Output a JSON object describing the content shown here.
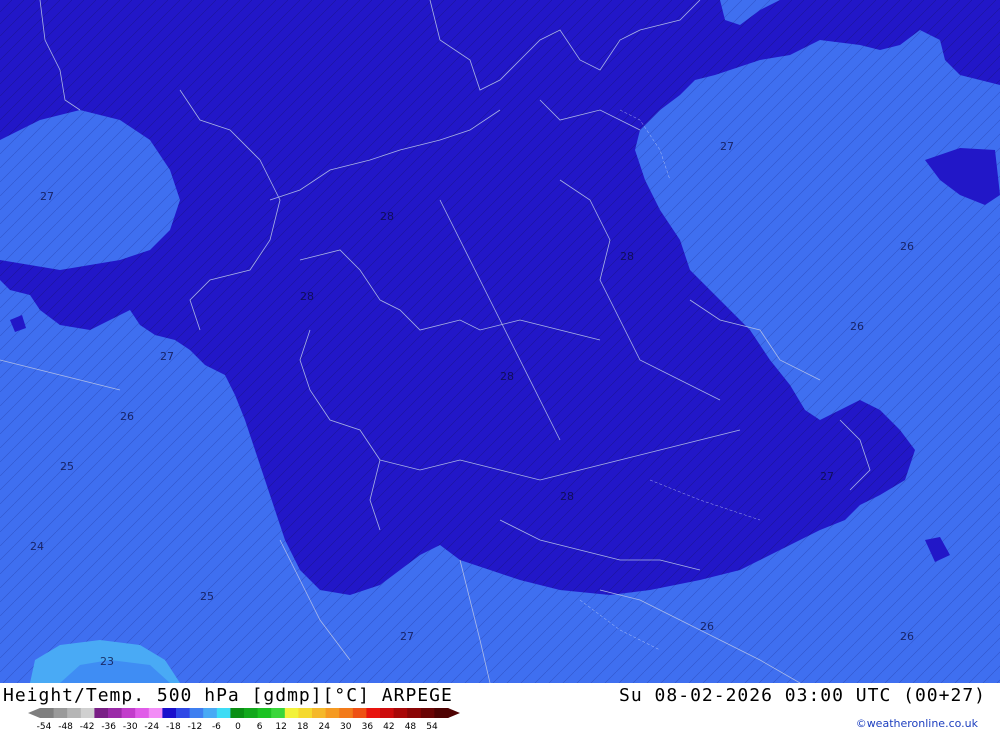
{
  "title": "Height/Temp. 500 hPa [gdmp][°C] ARPEGE",
  "valid_time": "Su 08-02-2026 03:00 UTC (00+27)",
  "credit": "©weatheronline.co.uk",
  "colorbar": {
    "labels": [
      "-54",
      "-48",
      "-42",
      "-36",
      "-30",
      "-24",
      "-18",
      "-12",
      "-6",
      "0",
      "6",
      "12",
      "18",
      "24",
      "30",
      "36",
      "42",
      "48",
      "54"
    ],
    "colors": [
      "#7f7f7f",
      "#9a9a9a",
      "#b5b5b5",
      "#d0d0d0",
      "#7a1f86",
      "#9b2aa8",
      "#c23ccb",
      "#e05ce8",
      "#f28cf6",
      "#1a0fcc",
      "#2f48e6",
      "#3f7ff0",
      "#49aaf5",
      "#3fdcf5",
      "#0a8f14",
      "#12a81c",
      "#1cc223",
      "#3ad63a",
      "#f2f23a",
      "#f5d92e",
      "#f5b82a",
      "#f59a22",
      "#f27a1a",
      "#ee5014",
      "#e8140e",
      "#cc0c0c",
      "#a80808",
      "#8a0606",
      "#6a0404",
      "#4e0202"
    ]
  },
  "map": {
    "region": "Central Europe",
    "field_colors": {
      "temp_-28_to_-24": "#1a0fcc",
      "temp_-24_to_-22": "#2f48e6",
      "temp_below_-22_light": "#3f7ff0",
      "temp_-22_and_above": "#49aaf5"
    },
    "contour_labels": [
      "28",
      "27",
      "26",
      "25",
      "24",
      "23"
    ]
  }
}
